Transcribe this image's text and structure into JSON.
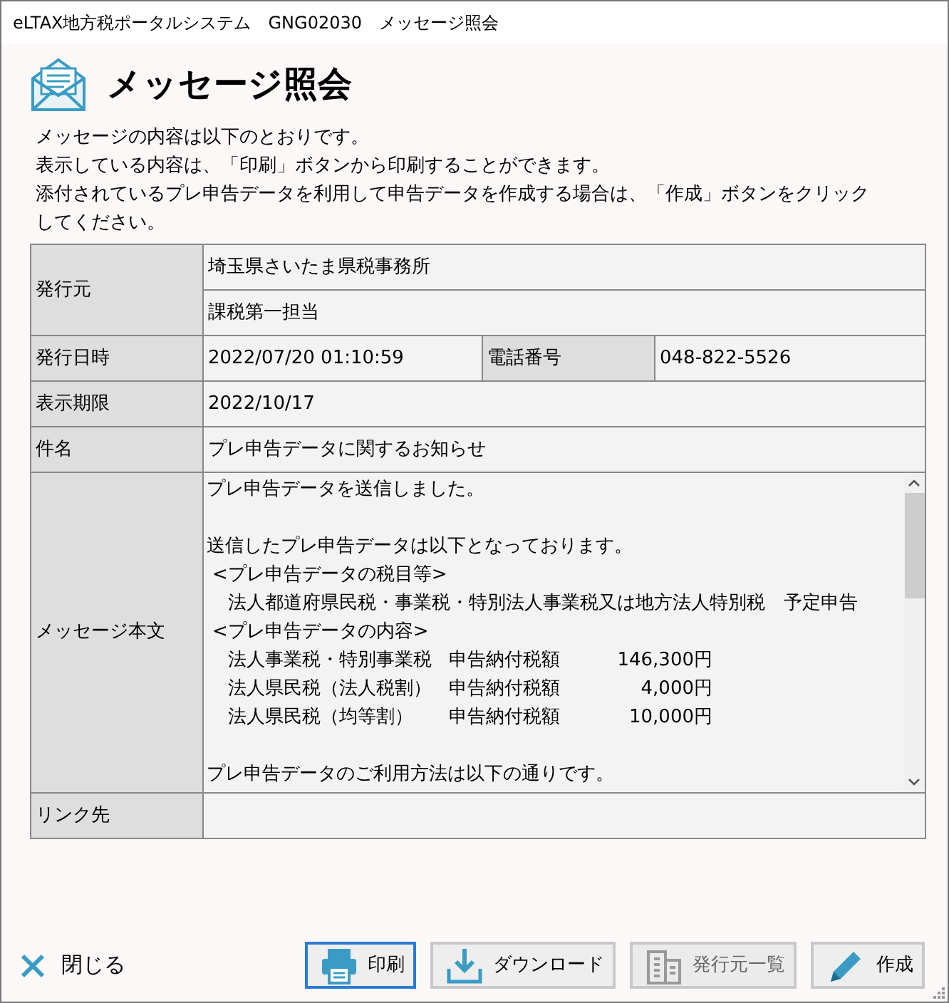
{
  "window": {
    "title": "eLTAX地方税ポータルシステム　GNG02030　メッセージ照会"
  },
  "header": {
    "title": "メッセージ照会"
  },
  "instructions": [
    "メッセージの内容は以下のとおりです。",
    "表示している内容は、「印刷」ボタンから印刷することができます。",
    "添付されているプレ申告データを利用して申告データを作成する場合は、「作成」ボタンをクリックしてください。"
  ],
  "details": {
    "issuer_label": "発行元",
    "issuer": [
      "埼玉県さいたま県税事務所",
      "課税第一担当"
    ],
    "date_label": "発行日時",
    "date": "2022/07/20 01:10:59",
    "phone_label": "電話番号",
    "phone": "048-822-5526",
    "expiry_label": "表示期限",
    "expiry": "2022/10/17",
    "subject_label": "件名",
    "subject": "プレ申告データに関するお知らせ",
    "body_label": "メッセージ本文",
    "body_lines": [
      {
        "kind": "text",
        "text": "プレ申告データを送信しました。"
      },
      {
        "kind": "blank"
      },
      {
        "kind": "text",
        "text": "送信したプレ申告データは以下となっております。"
      },
      {
        "kind": "heading",
        "text": "<プレ申告データの税目等>"
      },
      {
        "kind": "detail",
        "text": "法人都道府県民税・事業税・特別法人事業税又は地方法人特別税　予定申告"
      },
      {
        "kind": "heading",
        "text": "<プレ申告データの内容>"
      },
      {
        "kind": "amount",
        "item": "法人事業税・特別事業税",
        "label": "申告納付税額",
        "amount": "146,300円"
      },
      {
        "kind": "amount",
        "item": "法人県民税（法人税割）",
        "label": "申告納付税額",
        "amount": "4,000円"
      },
      {
        "kind": "amount",
        "item": "法人県民税（均等割）",
        "label": "申告納付税額",
        "amount": "10,000円"
      },
      {
        "kind": "blank"
      },
      {
        "kind": "text",
        "text": "プレ申告データのご利用方法は以下の通りです。"
      }
    ],
    "link_label": "リンク先"
  },
  "close": {
    "label": "閉じる"
  },
  "buttons": [
    {
      "kind": "print",
      "label": "印刷",
      "focused": true,
      "disabled": false
    },
    {
      "kind": "download",
      "label": "ダウンロード",
      "focused": false,
      "disabled": false
    },
    {
      "kind": "issuers",
      "label": "発行元一覧",
      "focused": false,
      "disabled": true
    },
    {
      "kind": "create",
      "label": "作成",
      "focused": false,
      "disabled": false
    }
  ]
}
